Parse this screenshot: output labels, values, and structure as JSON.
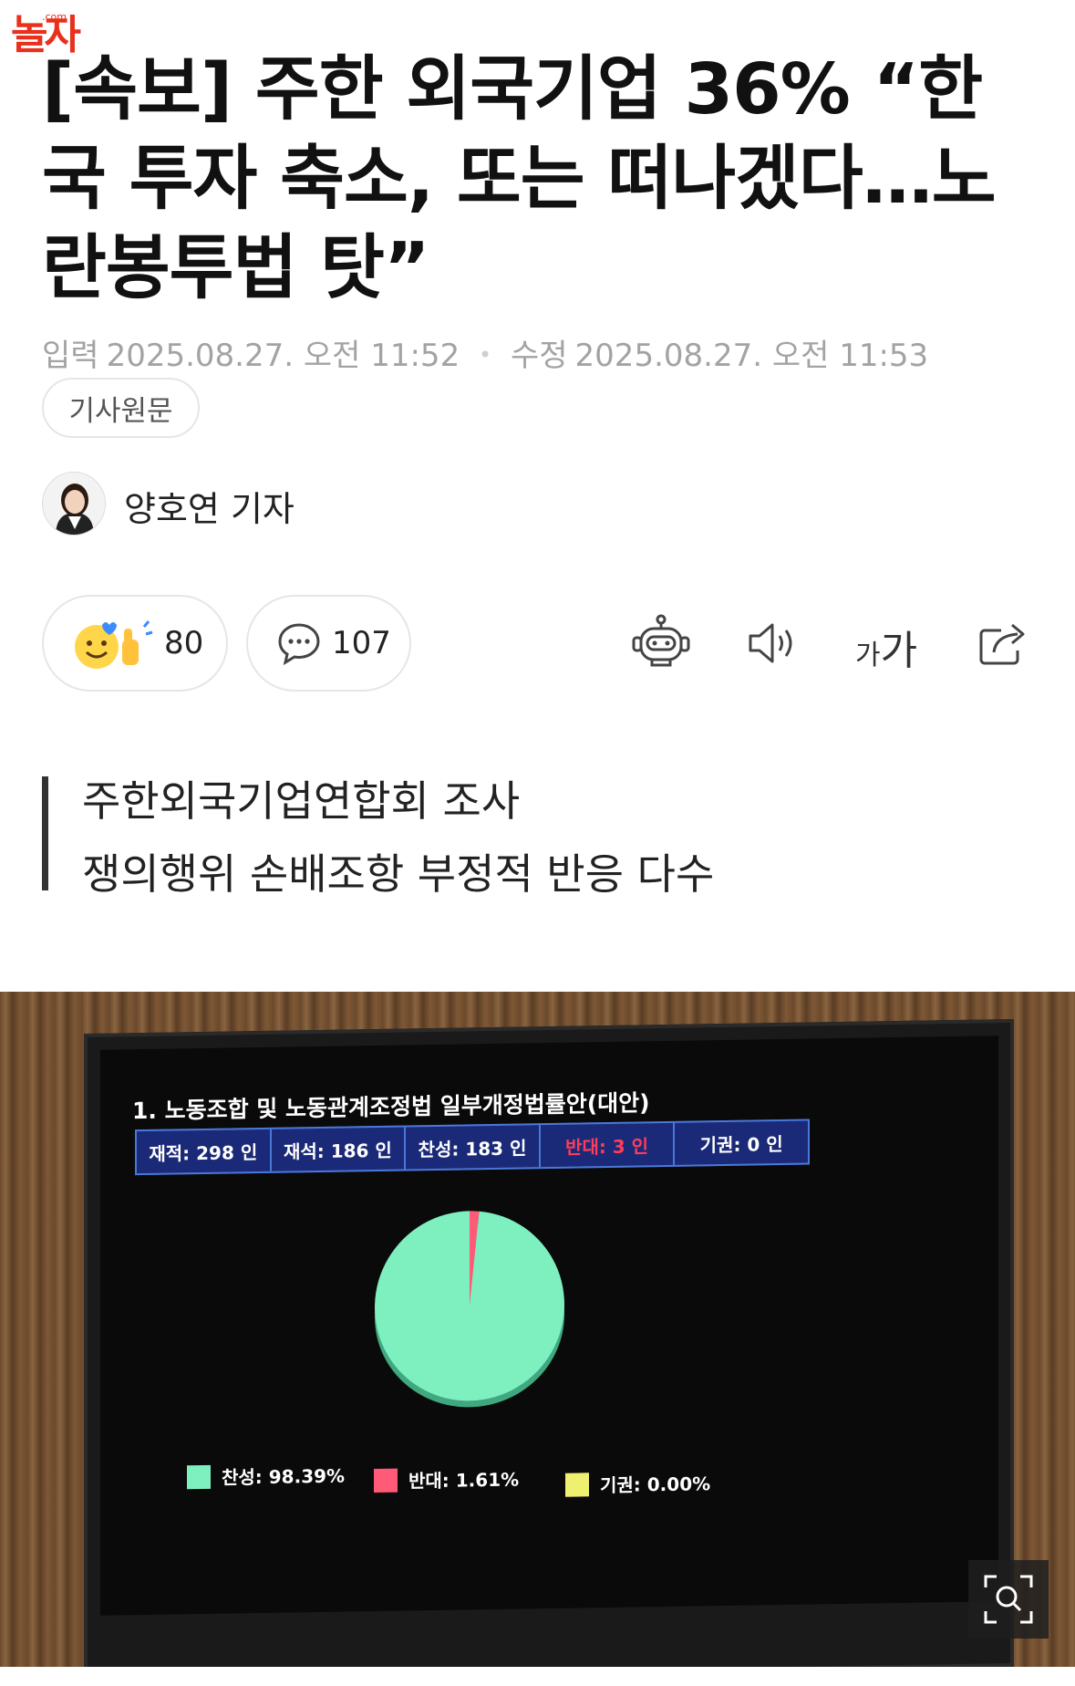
{
  "logo": {
    "text": "놀자",
    "domain": ".com"
  },
  "headline": "[속보] 주한 외국기업 36% “한국 투자 축소, 또는 떠나겠다…노란봉투법 탓”",
  "meta": {
    "input_label": "입력",
    "input_time": "2025.08.27. 오전 11:52",
    "edit_label": "수정",
    "edit_time": "2025.08.27. 오전 11:53"
  },
  "original_button": "기사원문",
  "reporter": "양호연 기자",
  "reactions": {
    "count": "80"
  },
  "comments": {
    "count": "107"
  },
  "toolbar": {
    "icons": [
      "robot-summary-icon",
      "speaker-icon",
      "font-size-icon",
      "share-icon"
    ],
    "font_label_small": "가",
    "font_label_large": "가"
  },
  "subtitle": {
    "line1": "주한외국기업연합회 조사",
    "line2": "쟁의행위 손배조항 부정적 반응 다수"
  },
  "vote_board": {
    "title": "1. 노동조합 및 노동관계조정법 일부개정법률안(대안)",
    "cells": [
      "재적: 298 인",
      "재석: 186 인",
      "찬성: 183 인",
      "반대:   3 인",
      "기권:   0 인"
    ],
    "legend": [
      {
        "label": "찬성: 98.39%",
        "color": "#7ef0c0"
      },
      {
        "label": "반대: 1.61%",
        "color": "#ff5a78"
      },
      {
        "label": "기권: 0.00%",
        "color": "#f0f070"
      }
    ]
  },
  "chart_data": {
    "type": "pie",
    "categories": [
      "찬성",
      "반대",
      "기권"
    ],
    "values": [
      98.39,
      1.61,
      0.0
    ],
    "colors": [
      "#7ef0c0",
      "#ff5a78",
      "#f0f070"
    ]
  },
  "colors": {
    "accent": "#e8301c",
    "meta": "#a3a3a3"
  }
}
